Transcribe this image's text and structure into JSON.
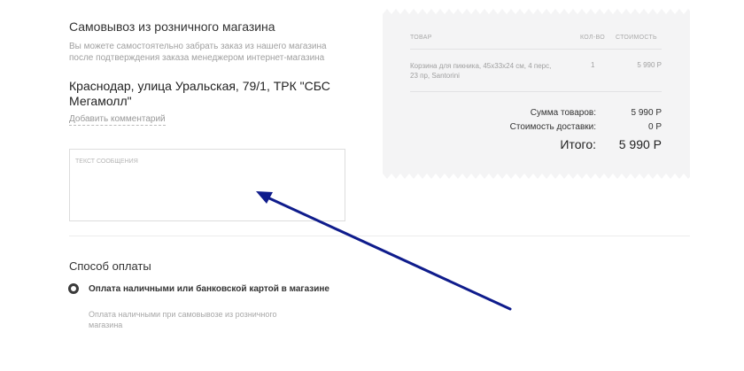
{
  "pickup": {
    "title": "Самовывоз из розничного магазина",
    "description": "Вы можете самостоятельно забрать заказ из нашего магазина после подтверждения заказа менеджером интернет-магазина",
    "address": "Краснодар, улица Уральская, 79/1, ТРК \"СБС Мегамолл\"",
    "add_comment_link": "Добавить комментарий",
    "comment_placeholder": "ТЕКСТ СООБЩЕНИЯ"
  },
  "order_summary": {
    "headers": {
      "product": "ТОВАР",
      "qty": "КОЛ-ВО",
      "cost": "СТОИМОСТЬ"
    },
    "items": [
      {
        "product": "Корзина для пикника, 45х33х24 см, 4 перс, 23 пр, Santorini",
        "qty": "1",
        "cost": "5 990 Р"
      }
    ],
    "goods_total_label": "Сумма товаров:",
    "goods_total_value": "5 990 Р",
    "delivery_label": "Стоимость доставки:",
    "delivery_value": "0 Р",
    "total_label": "Итого:",
    "total_value": "5 990 Р"
  },
  "payment": {
    "title": "Способ оплаты",
    "option_label": "Оплата наличными или банковской картой в магазине",
    "option_description": "Оплата наличными при самовывозе из розничного магазина",
    "selected": true
  },
  "colors": {
    "summary_bg": "#f4f4f5",
    "annotation_arrow": "#0f1c8c"
  },
  "icons": {
    "radio": "radio-selected-icon",
    "annotation": "arrow-annotation-icon"
  }
}
